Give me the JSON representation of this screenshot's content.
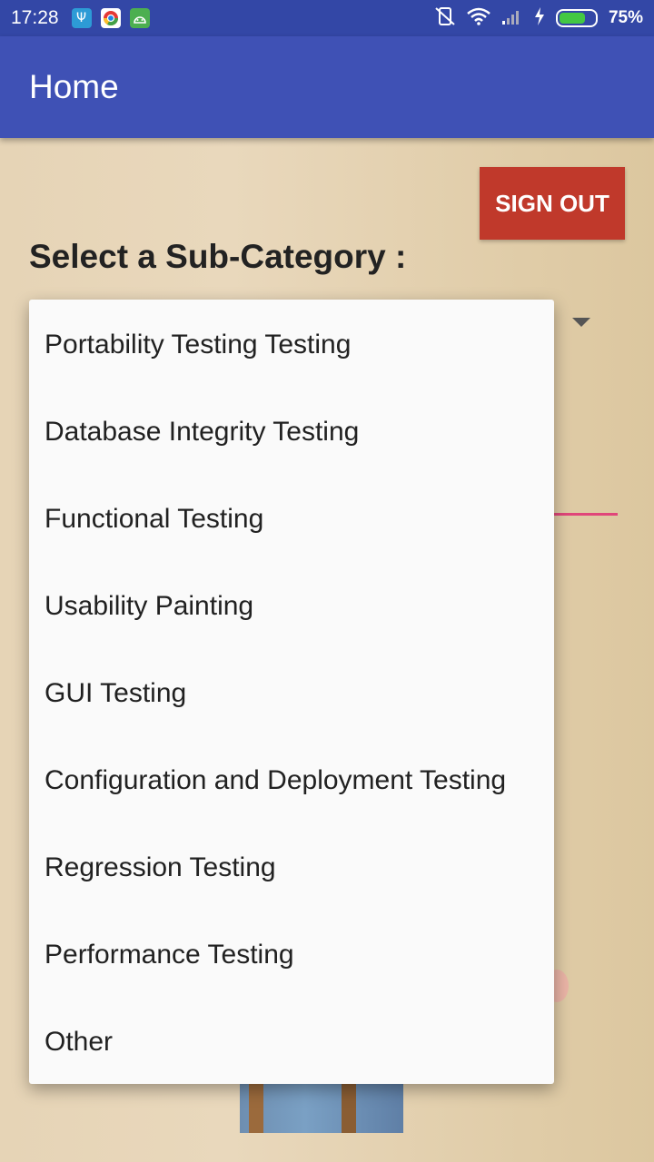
{
  "status_bar": {
    "time": "17:28",
    "battery_percent_label": "75%",
    "battery_level": 0.75,
    "icons": [
      "usb-icon",
      "chrome-app-icon",
      "android-app-icon",
      "vibrate-off-icon",
      "wifi-icon",
      "signal-icon",
      "charging-icon",
      "battery-icon"
    ]
  },
  "app_bar": {
    "title": "Home"
  },
  "sign_out_label": "SIGN OUT",
  "heading": "Select a Sub-Category :",
  "dropdown": {
    "items": [
      "Portability Testing Testing",
      "Database Integrity Testing",
      "Functional Testing",
      "Usability Painting",
      "GUI Testing",
      "Configuration and Deployment Testing",
      "Regression Testing",
      "Performance Testing",
      "Other"
    ]
  },
  "colors": {
    "status_bar": "#3347a6",
    "app_bar": "#3f51b5",
    "sign_out": "#c0392b",
    "accent_line": "#e0467a"
  }
}
